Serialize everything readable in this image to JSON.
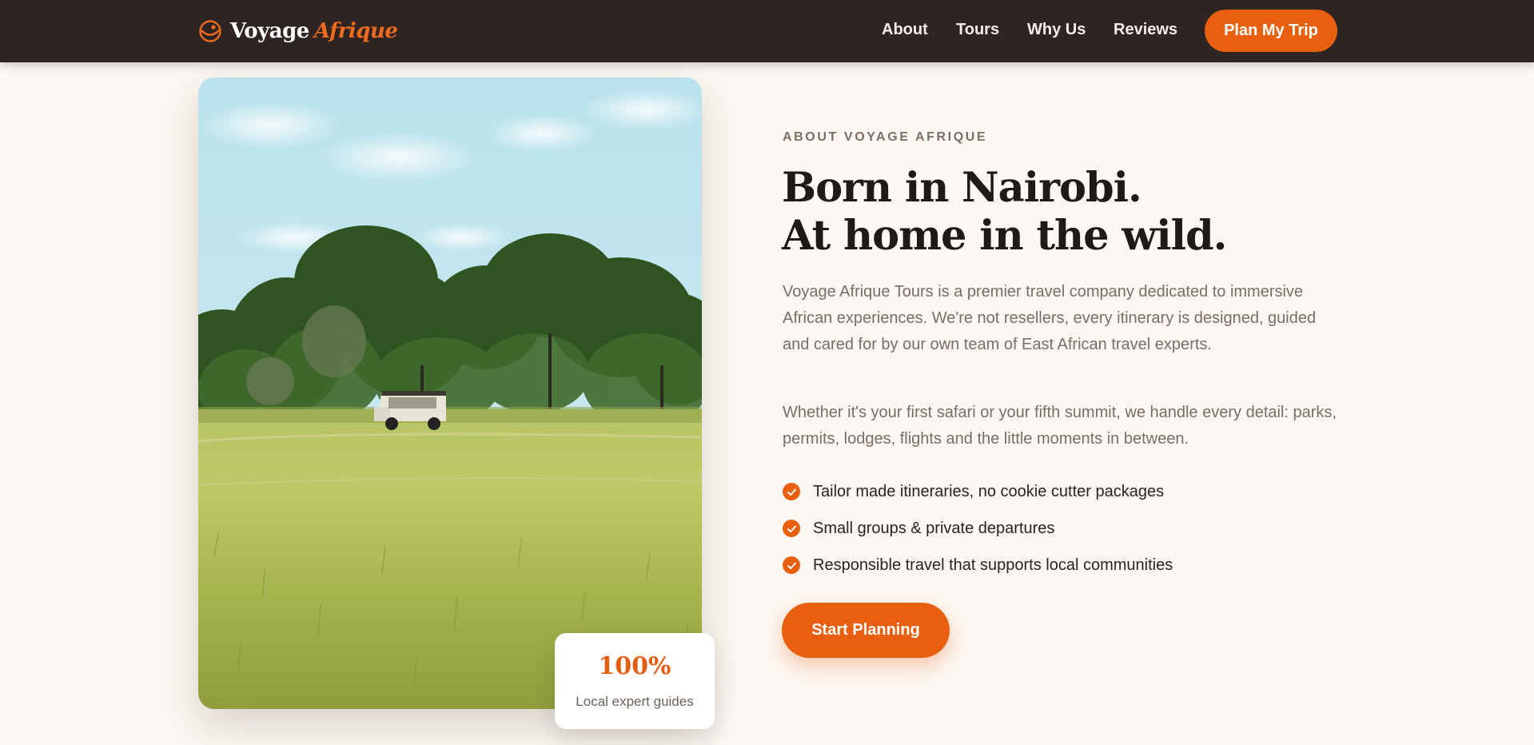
{
  "brand": {
    "word1": "Voyage",
    "word2": "Afrique",
    "accent_color": "#e8600f",
    "dark_color": "#2e2522"
  },
  "nav": {
    "links": [
      "About",
      "Tours",
      "Why Us",
      "Reviews"
    ],
    "cta": "Plan My Trip"
  },
  "about": {
    "eyebrow": "ABOUT VOYAGE AFRIQUE",
    "headline_line1": "Born in Nairobi.",
    "headline_line2": "At home in the wild.",
    "paragraph1": "Voyage Afrique Tours is a premier travel company dedicated to immersive African experiences. We're not resellers, every itinerary is designed, guided and cared for by our own team of East African travel experts.",
    "paragraph2": "Whether it's your first safari or your fifth summit, we handle every detail: parks, permits, lodges, flights and the little moments in between.",
    "features": [
      "Tailor made itineraries, no cookie cutter packages",
      "Small groups & private departures",
      "Responsible travel that supports local communities"
    ],
    "cta": "Start Planning"
  },
  "stat": {
    "value": "100%",
    "label": "Local expert guides"
  },
  "image": {
    "subject": "safari-vehicle-in-savanna-grassland"
  }
}
